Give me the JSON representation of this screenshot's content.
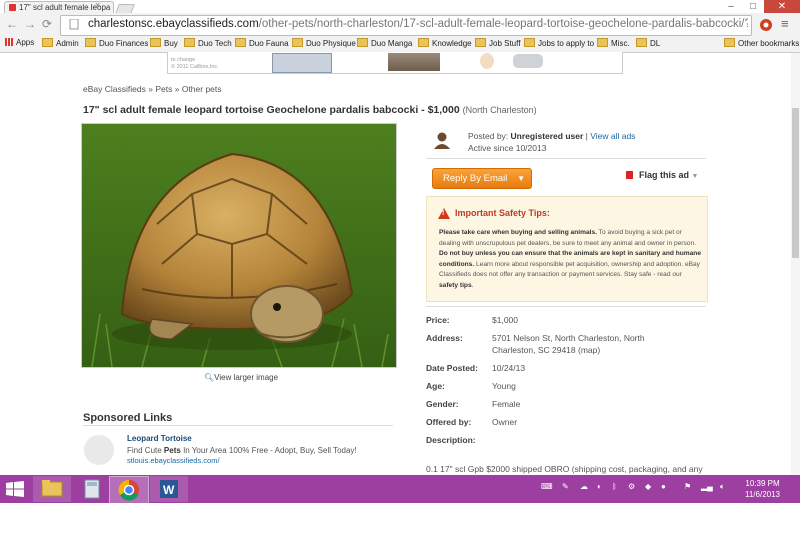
{
  "browser": {
    "tab_title": "17\" scl adult female leopa",
    "tab_close": "×",
    "url_domain": "charlestonsc.ebayclassifieds.com",
    "url_path": "/other-pets/north-charleston/17-scl-adult-female-leopard-tortoise-geochelone-pardalis-babcocki/?ad=30257218&m",
    "bookmarks": [
      "Apps",
      "Admin",
      "Duo Finances",
      "Buy",
      "Duo Tech",
      "Duo Fauna",
      "Duo Physique",
      "Duo Manga",
      "Knowledge",
      "Job Stuff",
      "Jobs to apply to",
      "Misc.",
      "DL",
      "Other bookmarks"
    ]
  },
  "ad": {
    "text_line1": "to change",
    "text_line2": "© 2011 Callbox,Inc."
  },
  "breadcrumb": [
    "eBay Classifieds",
    "Pets",
    "Other pets"
  ],
  "breadcrumb_sep": "»",
  "listing": {
    "title": "17\" scl adult female leopard tortoise Geochelone pardalis babcocki - $1,000",
    "location": "(North Charleston)",
    "view_larger": "View larger image",
    "posted_by_label": "Posted by:",
    "posted_by": "Unregistered user",
    "view_all_ads": "View all ads",
    "active_since": "Active since 10/2013",
    "reply_button": "Reply By Email",
    "flag": "Flag this ad",
    "safety_title": "Important Safety Tips:",
    "safety_bold1": "Please take care when buying and selling animals.",
    "safety_text1": "To avoid buying a sick pet or dealing with unscrupulous pet dealers, be sure to meet any animal and owner in person.",
    "safety_bold2": "Do not buy unless you can ensure that the animals are kept in sanitary and humane conditions.",
    "safety_text2": "Learn more about responsible pet acquisition, ownership and adoption. eBay Classifieds does not offer any transaction or payment services. Stay safe - read our",
    "safety_link": "safety tips",
    "details": [
      {
        "label": "Price:",
        "value": "$1,000"
      },
      {
        "label": "Address:",
        "value": "5701 Nelson St, North Charleston, North"
      },
      {
        "label": "Date Posted:",
        "value": "10/24/13"
      },
      {
        "label": "Age:",
        "value": "Young"
      },
      {
        "label": "Gender:",
        "value": "Female"
      },
      {
        "label": "Offered by:",
        "value": "Owner"
      },
      {
        "label": "Description:",
        "value": ""
      }
    ],
    "address_line2": "Charleston, SC 29418 (map)",
    "description_start": "0.1 17\" scl Gpb $2000 shipped OBRO (shipping cost, packaging, and any"
  },
  "sponsored": {
    "heading": "Sponsored Links",
    "title": "Leopard Tortoise",
    "desc_before": "Find Cute",
    "desc_bold": "Pets",
    "desc_after": "In Your Area 100% Free - Adopt, Buy, Sell Today!",
    "url": "stlouis.ebayclassifieds.com/"
  },
  "taskbar": {
    "time": "10:39 PM",
    "date": "11/6/2013"
  },
  "colors": {
    "taskbar": "#9d3fa0",
    "reply_button": "#f28c1e",
    "safety_title": "#c0392b",
    "link": "#1a6aa0"
  }
}
